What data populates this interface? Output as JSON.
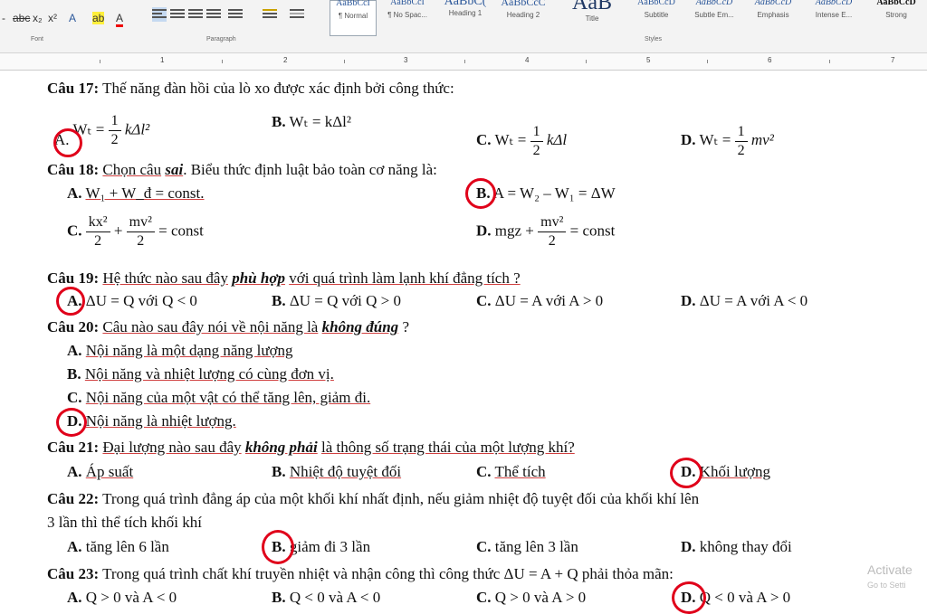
{
  "ribbon": {
    "format_buttons": [
      "-",
      "abc",
      "x₂",
      "x²",
      "A",
      "ab",
      "A"
    ],
    "paragraph_group": "Paragraph",
    "font_group": "Font",
    "styles_group": "Styles",
    "styles": [
      {
        "sample": "AaBbCcI",
        "name": "¶ Normal"
      },
      {
        "sample": "AaBbCcI",
        "name": "¶ No Spac..."
      },
      {
        "sample": "AaBbC(",
        "name": "Heading 1"
      },
      {
        "sample": "AaBbCcC",
        "name": "Heading 2"
      },
      {
        "sample": "AaB",
        "name": "Title"
      },
      {
        "sample": "AaBbCcD",
        "name": "Subtitle"
      },
      {
        "sample": "AaBbCcD",
        "name": "Subtle Em..."
      },
      {
        "sample": "AaBbCcD",
        "name": "Emphasis"
      },
      {
        "sample": "AaBbCcD",
        "name": "Intense E..."
      },
      {
        "sample": "AaBbCcD",
        "name": "Strong"
      }
    ]
  },
  "ruler": {
    "numbers": [
      "1",
      "2",
      "3",
      "4",
      "5",
      "6",
      "7"
    ]
  },
  "doc": {
    "q17": {
      "num": "Câu 17:",
      "text": "Thế năng đàn hồi của lò xo được xác định bởi công thức:",
      "a": {
        "label": "A.",
        "lhs": "Wₜ =",
        "num": "1",
        "den": "2",
        "rest": "kΔl²"
      },
      "b": {
        "label": "B.",
        "expr": "Wₜ = kΔl²"
      },
      "c": {
        "label": "C.",
        "lhs": "Wₜ =",
        "num": "1",
        "den": "2",
        "rest": "kΔl"
      },
      "d": {
        "label": "D.",
        "lhs": "Wₜ =",
        "num": "1",
        "den": "2",
        "rest": "mv²"
      }
    },
    "q18": {
      "num": "Câu 18:",
      "pre": "Chọn câu",
      "emph": "sai",
      "post": ". Biểu thức định luật bảo toàn cơ năng là:",
      "a": {
        "label": "A.",
        "expr": "W₁ + W_đ = const."
      },
      "b": {
        "label": "B.",
        "expr": "A = W₂ – W₁ = ΔW"
      },
      "c": {
        "label": "C.",
        "n1": "kx²",
        "d1": "2",
        "plus": "+",
        "n2": "mv²",
        "d2": "2",
        "tail": "= const"
      },
      "d": {
        "label": "D.",
        "pre": "mgz +",
        "n": "mv²",
        "d": "2",
        "tail": "= const"
      }
    },
    "q19": {
      "num": "Câu 19:",
      "pre": "Hệ thức nào sau đây",
      "emph": "phù hợp",
      "post": "với quá trình làm lạnh khí đẳng tích ?",
      "a": {
        "label": "A.",
        "expr": "ΔU = Q với Q < 0"
      },
      "b": {
        "label": "B.",
        "expr": "ΔU = Q với Q > 0"
      },
      "c": {
        "label": "C.",
        "expr": "ΔU = A với A > 0"
      },
      "d": {
        "label": "D.",
        "expr": "ΔU = A với A < 0"
      }
    },
    "q20": {
      "num": "Câu 20:",
      "pre": "Câu nào sau đây nói về nội năng là",
      "emph": "không đúng",
      "post": "?",
      "a": {
        "label": "A.",
        "expr": "Nội năng là một dạng năng lượng"
      },
      "b": {
        "label": "B.",
        "expr": "Nội năng và nhiệt lượng có cùng đơn vị."
      },
      "c": {
        "label": "C.",
        "expr": "Nội năng của một vật có thể tăng lên, giảm đi."
      },
      "d": {
        "label": "D.",
        "expr": "Nội năng là nhiệt lượng."
      }
    },
    "q21": {
      "num": "Câu 21:",
      "pre": "Đại lượng nào sau đây",
      "emph": "không phải",
      "post": "là thông số trạng thái của một lượng khí?",
      "a": {
        "label": "A.",
        "expr": "Áp suất"
      },
      "b": {
        "label": "B.",
        "expr": "Nhiệt độ tuyệt đối"
      },
      "c": {
        "label": "C.",
        "expr": "Thể tích"
      },
      "d": {
        "label": "D.",
        "expr": "Khối lượng"
      }
    },
    "q22": {
      "num": "Câu 22:",
      "text1": "Trong quá trình đẳng áp của một khối khí nhất định, nếu giảm nhiệt độ tuyệt đối của khối khí lên",
      "text2": "3 lần thì thể tích khối khí",
      "a": {
        "label": "A.",
        "expr": "tăng lên 6 lần"
      },
      "b": {
        "label": "B.",
        "expr": "giảm đi 3 lần"
      },
      "c": {
        "label": "C.",
        "expr": "tăng lên 3 lần"
      },
      "d": {
        "label": "D.",
        "expr": "không thay đổi"
      }
    },
    "q23": {
      "num": "Câu 23:",
      "text": "Trong quá trình chất khí truyền nhiệt và nhận công thì công thức ΔU = A + Q phải thỏa mãn:",
      "a": {
        "label": "A.",
        "expr": "Q > 0 và A < 0"
      },
      "b": {
        "label": "B.",
        "expr": "Q < 0 và A < 0"
      },
      "c": {
        "label": "C.",
        "expr": "Q > 0 và A > 0"
      },
      "d": {
        "label": "D.",
        "expr": "Q < 0 và A > 0"
      }
    }
  },
  "watermark": {
    "line1": "Activate",
    "line2": "Go to Setti"
  }
}
